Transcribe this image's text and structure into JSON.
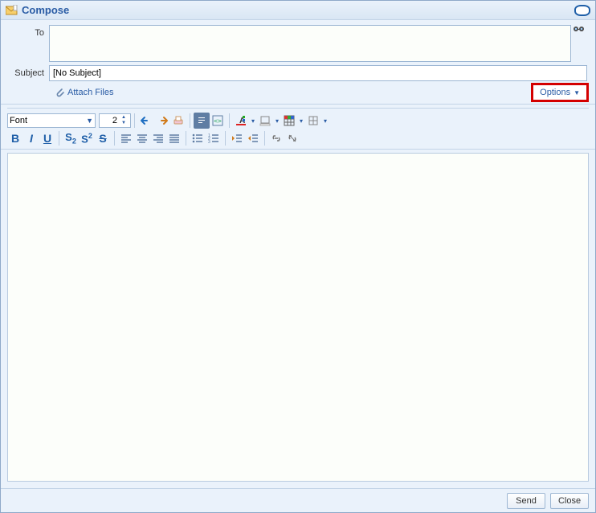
{
  "title": "Compose",
  "fields": {
    "to_label": "To",
    "to_value": "",
    "subject_label": "Subject",
    "subject_value": "[No Subject]"
  },
  "attach_label": "Attach Files",
  "options_label": "Options",
  "toolbar": {
    "font_label": "Font",
    "font_size": "2"
  },
  "footer": {
    "send": "Send",
    "close": "Close"
  }
}
